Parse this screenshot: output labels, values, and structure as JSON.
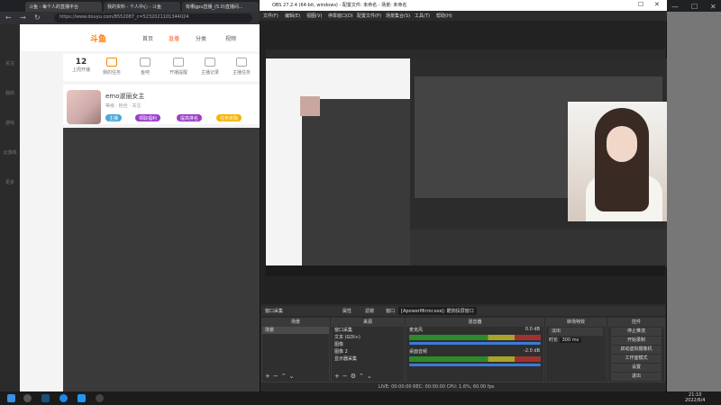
{
  "browser": {
    "tabs": [
      {
        "label": "斗鱼 - 每个人的直播平台"
      },
      {
        "label": "我的资料 - 个人中心 - 斗鱼"
      },
      {
        "label": "有哪gpu直播_(5.0)直播间..."
      }
    ],
    "url": "https://www.douyu.com/8552087_c=5232021101344024"
  },
  "douyu": {
    "logo": "斗鱼",
    "nav": [
      "首页",
      "直播",
      "分类",
      "视频"
    ],
    "stats": [
      {
        "value": "12",
        "label": "上周开播"
      },
      {
        "value": "",
        "label": "我的任务"
      },
      {
        "value": "",
        "label": "鱼吧"
      },
      {
        "value": "",
        "label": "开播提醒"
      },
      {
        "value": "",
        "label": "主播记录"
      },
      {
        "value": "",
        "label": "主播任务"
      }
    ],
    "profile": {
      "name": "emo淑丽女主",
      "sub": "等级 · 粉丝 · 关注",
      "pills": [
        "主播",
        "领取福利",
        "提高排名",
        "任务奖励"
      ]
    },
    "sidebar": [
      "关注",
      "我的",
      "游戏",
      "云游戏",
      "更多"
    ]
  },
  "obs": {
    "title": "OBS 27.2.4 (64-bit, windows) - 配置文件: 未命名 - 场景: 未命名",
    "menu": [
      "文件(F)",
      "编辑(E)",
      "视图(V)",
      "停靠窗口(D)",
      "配置文件(P)",
      "场景集合(S)",
      "工具(T)",
      "帮助(H)"
    ],
    "source_bar": {
      "selected": "窗口采集",
      "props": "属性",
      "filters": "滤镜",
      "window_label": "窗口",
      "window_value": "[ApowerMirror.exe]: 酷狗投屏窗口"
    },
    "scenes": {
      "header": "场景",
      "items": [
        "场景"
      ]
    },
    "sources": {
      "header": "来源",
      "items": [
        "窗口采集",
        "文本 (GDI+)",
        "图像",
        "图像 2",
        "显示器采集"
      ]
    },
    "mixer": {
      "header": "混音器",
      "tracks": [
        {
          "name": "麦克风",
          "db": "0.0 dB"
        },
        {
          "name": "桌面音频",
          "db": "-2.0 dB"
        }
      ]
    },
    "transitions": {
      "header": "转场特效",
      "type": "淡出",
      "duration_label": "时长",
      "duration": "300 ms"
    },
    "controls": {
      "header": "控件",
      "buttons": [
        "停止推流",
        "开始录制",
        "启动虚拟摄像机",
        "工作室模式",
        "设置",
        "退出"
      ]
    },
    "status": "LIVE: 00:00:00   REC: 00:00:00   CPU: 1.6%, 60.00 fps"
  },
  "taskbar": {
    "time": "21:10",
    "date": "2022/6/4"
  }
}
